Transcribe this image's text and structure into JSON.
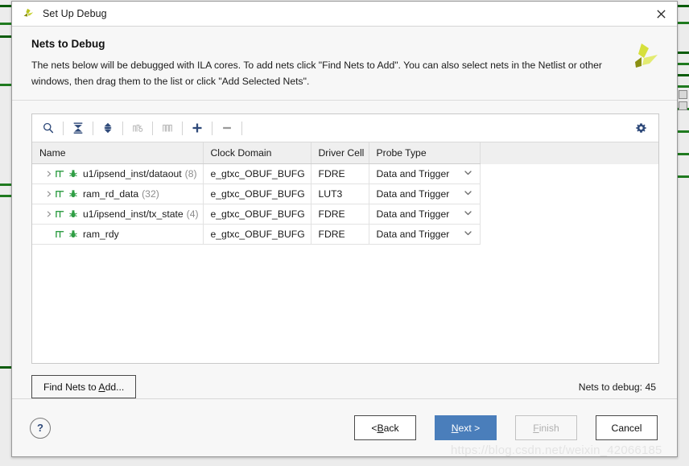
{
  "window": {
    "title": "Set Up Debug",
    "logo_icon": "vivado-logo-icon",
    "close_icon": "close-icon"
  },
  "header": {
    "title": "Nets to Debug",
    "description": "The nets below will be debugged with ILA cores. To add nets click \"Find Nets to Add\". You can also select nets in the Netlist or other windows, then drag them to the list or click \"Add Selected Nets\".",
    "brand_logo_icon": "xilinx-logo-icon"
  },
  "toolbar": {
    "buttons": [
      {
        "name": "search-icon",
        "label": "Search",
        "enabled": true
      },
      {
        "name": "collapse-all-icon",
        "label": "Collapse All",
        "enabled": true
      },
      {
        "name": "expand-all-icon",
        "label": "Expand All",
        "enabled": true
      },
      {
        "name": "select-clock-domain-icon",
        "label": "Select Clock Domain",
        "enabled": false
      },
      {
        "name": "select-nets-icon",
        "label": "Select Nets",
        "enabled": false
      },
      {
        "name": "add-nets-icon",
        "label": "Add Selected Nets",
        "enabled": true
      },
      {
        "name": "remove-nets-icon",
        "label": "Remove Nets",
        "enabled": true
      }
    ],
    "settings_icon": "gear-icon"
  },
  "table": {
    "columns": [
      "Name",
      "Clock Domain",
      "Driver Cell",
      "Probe Type"
    ],
    "rows": [
      {
        "expandable": true,
        "name": "u1/ipsend_inst/dataout",
        "count": "(8)",
        "clock_domain": "e_gtxc_OBUF_BUFG",
        "driver_cell": "FDRE",
        "probe_type": "Data and Trigger"
      },
      {
        "expandable": true,
        "name": "ram_rd_data",
        "count": "(32)",
        "clock_domain": "e_gtxc_OBUF_BUFG",
        "driver_cell": "LUT3",
        "probe_type": "Data and Trigger"
      },
      {
        "expandable": true,
        "name": "u1/ipsend_inst/tx_state",
        "count": "(4)",
        "clock_domain": "e_gtxc_OBUF_BUFG",
        "driver_cell": "FDRE",
        "probe_type": "Data and Trigger"
      },
      {
        "expandable": false,
        "name": "ram_rdy",
        "count": "",
        "clock_domain": "e_gtxc_OBUF_BUFG",
        "driver_cell": "FDRE",
        "probe_type": "Data and Trigger"
      }
    ]
  },
  "panel_footer": {
    "find_nets_label_pre": "Find Nets to ",
    "find_nets_mnemonic": "A",
    "find_nets_label_post": "dd...",
    "nets_to_debug": "Nets to debug: 45"
  },
  "footer": {
    "help_label": "?",
    "back": {
      "pre": "< ",
      "mnemonic": "B",
      "post": "ack"
    },
    "next": {
      "pre": "",
      "mnemonic": "N",
      "post": "ext >"
    },
    "finish": {
      "pre": "",
      "mnemonic": "F",
      "post": "inish"
    },
    "cancel": {
      "pre": "Cancel",
      "mnemonic": "",
      "post": ""
    }
  },
  "watermark": "https://blog.csdn.net/weixin_42066185",
  "colors": {
    "primary_button": "#4a7ebb",
    "icon_blue": "#2f4a7a",
    "icon_disabled": "#b9b9b9",
    "net_icon_green": "#2f9e44",
    "logo_yellow": "#d6e03c",
    "logo_olive": "#8a8f12",
    "background_green": "#1f7a1f"
  }
}
